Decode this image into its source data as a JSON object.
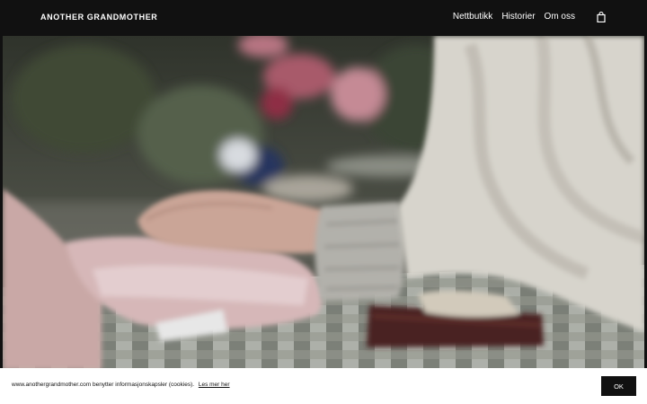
{
  "header": {
    "brand": "ANOTHER GRANDMOTHER",
    "nav": [
      {
        "label": "Nettbutikk"
      },
      {
        "label": "Historier"
      },
      {
        "label": "Om oss"
      }
    ],
    "cart_icon": "shopping-bag-icon"
  },
  "hero": {
    "media": "video-frame"
  },
  "cookie": {
    "text": "www.anothergrandmother.com benytter informasjonskapsler (cookies).",
    "link_label": "Les mer her",
    "ok_label": "OK"
  },
  "colors": {
    "header_bg": "#111111",
    "cookie_bg": "#ffffff",
    "button_bg": "#111111"
  }
}
